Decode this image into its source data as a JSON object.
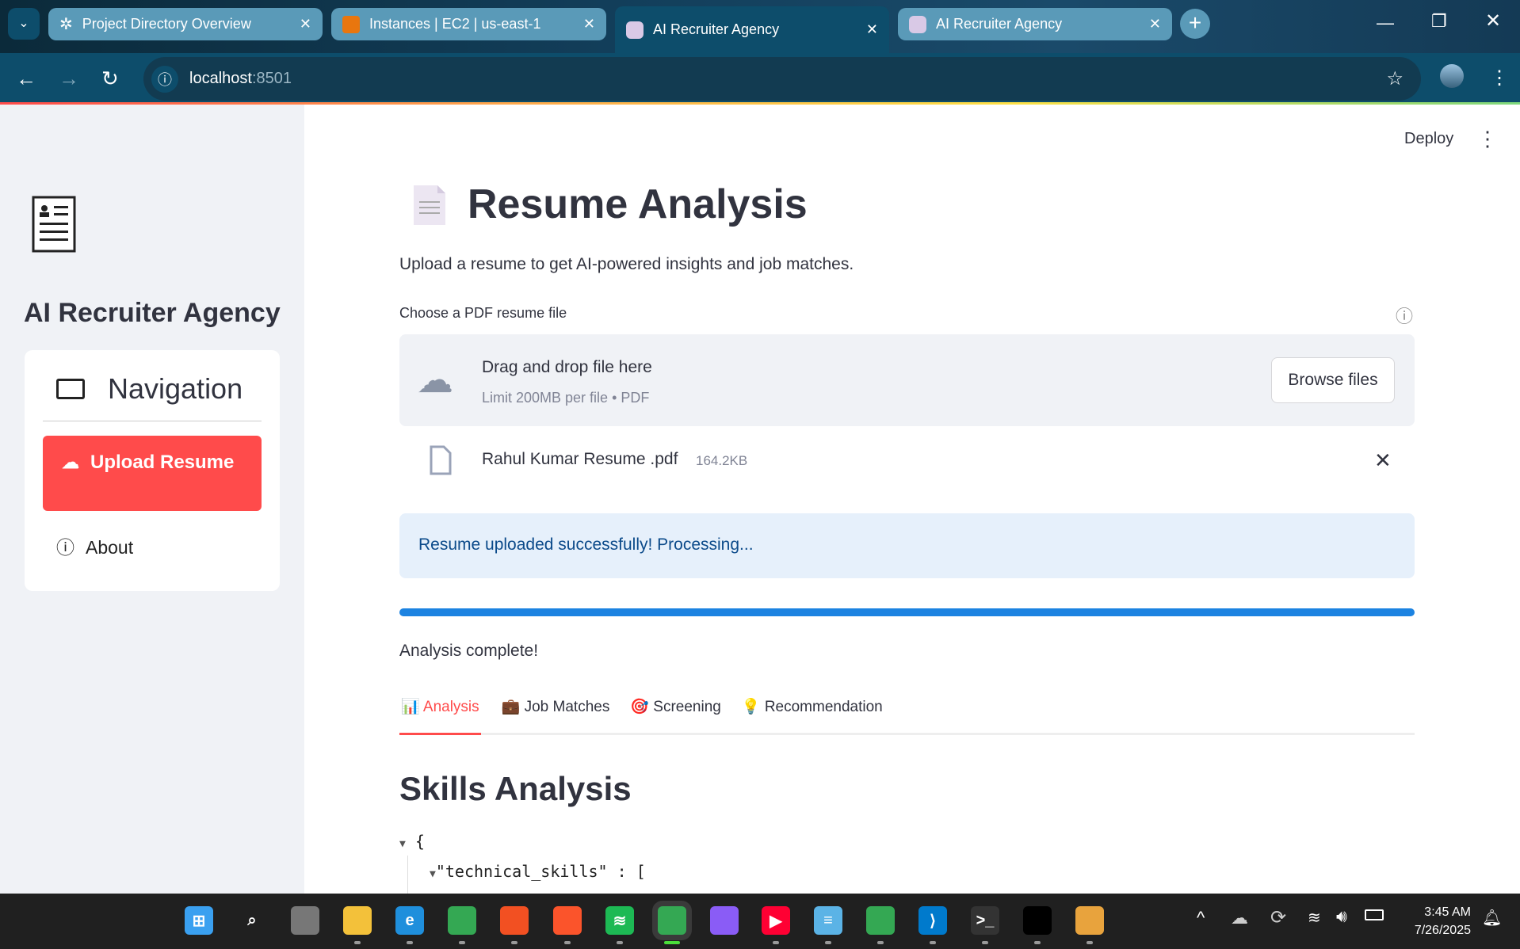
{
  "browser": {
    "tabs": [
      {
        "title": "Project Directory Overview",
        "icon": "openai-icon",
        "active": false
      },
      {
        "title": "Instances | EC2 | us-east-1",
        "icon": "aws-ec2-icon",
        "active": false
      },
      {
        "title": "AI Recruiter Agency",
        "icon": "robot-icon",
        "active": true
      },
      {
        "title": "AI Recruiter Agency",
        "icon": "robot-icon",
        "active": false
      }
    ],
    "url_host": "localhost",
    "url_port": ":8501"
  },
  "app": {
    "deploy_label": "Deploy",
    "sidebar": {
      "title": "AI Recruiter Agency",
      "nav_title": "Navigation",
      "items": [
        {
          "label": "Upload Resume",
          "icon": "cloud-upload-icon",
          "active": true
        },
        {
          "label": "About",
          "icon": "info-icon",
          "active": false
        }
      ]
    },
    "title": "Resume Analysis",
    "subtitle": "Upload a resume to get AI-powered insights and job matches.",
    "uploader": {
      "label": "Choose a PDF resume file",
      "drag_text": "Drag and drop file here",
      "limit_text": "Limit 200MB per file • PDF",
      "browse_label": "Browse files",
      "file_name": "Rahul Kumar Resume .pdf",
      "file_size": "164.2KB"
    },
    "info_message": "Resume uploaded successfully! Processing...",
    "progress": 1.0,
    "status_text": "Analysis complete!",
    "tabs": [
      {
        "label": "Analysis",
        "icon": "📊",
        "active": true
      },
      {
        "label": "Job Matches",
        "icon": "💼",
        "active": false
      },
      {
        "label": "Screening",
        "icon": "🎯",
        "active": false
      },
      {
        "label": "Recommendation",
        "icon": "💡",
        "active": false
      }
    ],
    "section_title": "Skills Analysis",
    "json_view": {
      "open_brace": "{",
      "key": "\"technical_skills\"",
      "after_key": " : ["
    }
  },
  "colors": {
    "primary": "#ff4b4b",
    "progress": "#1c83e1",
    "info_bg": "#e6f0fb",
    "info_text": "#0b4a8a"
  },
  "taskbar": {
    "apps": [
      "start",
      "search",
      "task-view",
      "file-explorer",
      "edge",
      "chrome",
      "microsoft-store",
      "brave",
      "spotify",
      "chrome-active",
      "copilot",
      "youtube",
      "notepad",
      "chrome-profile",
      "vscode",
      "terminal",
      "command-prompt",
      "git-kraken"
    ],
    "time": "3:45 AM",
    "date": "7/26/2025"
  }
}
